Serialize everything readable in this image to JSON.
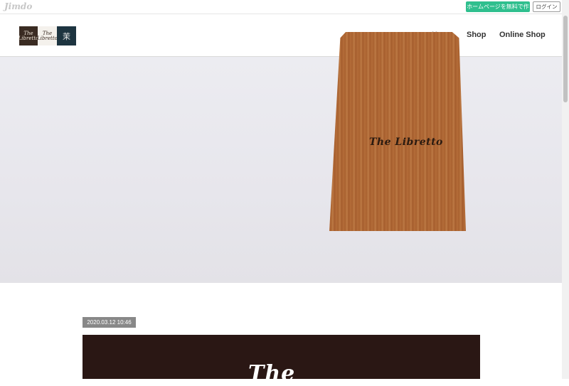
{
  "topbar": {
    "logo_text": "Jimdo",
    "create_button": "ホームページを無料で作成",
    "login_button": "ログイン"
  },
  "header": {
    "logo": {
      "tile1": "The Libretto",
      "tile2": "The Libretto",
      "tile3": "茉"
    },
    "nav": {
      "home": "Home",
      "shop": "Shop",
      "online_shop": "Online Shop"
    }
  },
  "hero": {
    "board_text": "The Libretto"
  },
  "post": {
    "date": "2020.03.12 10:46",
    "image_text": "The"
  }
}
